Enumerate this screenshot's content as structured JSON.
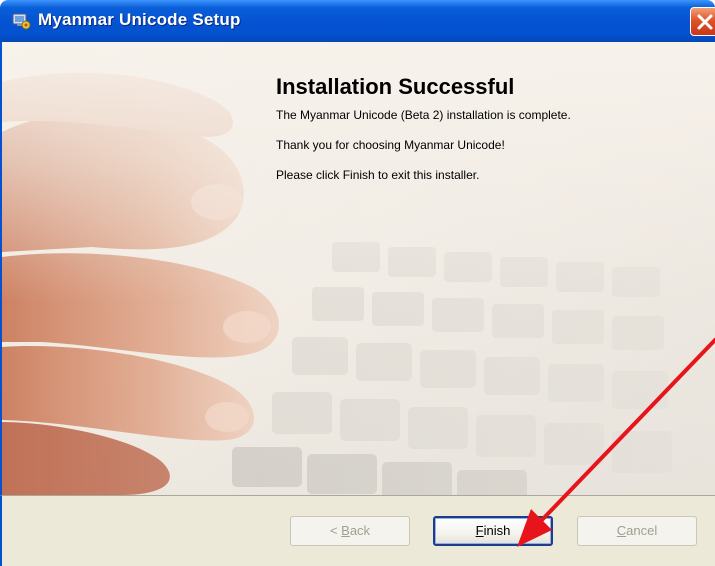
{
  "window": {
    "title": "Myanmar Unicode Setup",
    "icon": "setup-icon",
    "close_icon": "close-icon"
  },
  "content": {
    "heading": "Installation Successful",
    "line1": "The Myanmar Unicode (Beta 2) installation is complete.",
    "line2": "Thank you for choosing Myanmar Unicode!",
    "line3": "Please click Finish to exit this installer."
  },
  "buttons": {
    "back": {
      "prefix": "< ",
      "mnemonic": "B",
      "rest": "ack",
      "enabled": false
    },
    "finish": {
      "prefix": "",
      "mnemonic": "F",
      "rest": "inish",
      "enabled": true
    },
    "cancel": {
      "prefix": "",
      "mnemonic": "C",
      "rest": "ancel",
      "enabled": false
    }
  },
  "colors": {
    "titlebar": "#0553d3",
    "annotation_arrow": "#e8141b"
  }
}
